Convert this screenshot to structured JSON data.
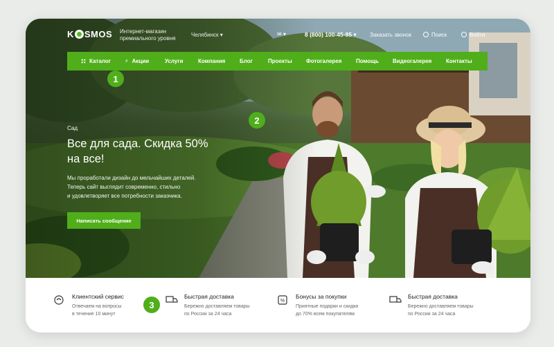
{
  "brand": {
    "logo_text_left": "K",
    "logo_text_right": "SMOS",
    "tagline_line1": "Интернет-магазин",
    "tagline_line2": "премиального уровня"
  },
  "header": {
    "city": "Челябинск",
    "phone": "8 (800) 100-45-85",
    "callback": "Заказать звонок",
    "search": "Поиск",
    "login": "Войти"
  },
  "nav": {
    "items": [
      {
        "label": "Каталог",
        "icon": "grid-icon"
      },
      {
        "label": "Акции",
        "icon": "bolt-icon"
      },
      {
        "label": "Услуги"
      },
      {
        "label": "Компания"
      },
      {
        "label": "Блог"
      },
      {
        "label": "Проекты"
      },
      {
        "label": "Фотогалерея"
      },
      {
        "label": "Помощь"
      },
      {
        "label": "Видеогалерея"
      },
      {
        "label": "Контакты"
      }
    ]
  },
  "hero": {
    "eyebrow": "Сад",
    "title_line1": "Все для сада. Скидка 50%",
    "title_line2": "на все!",
    "desc_line1": "Мы проработали дизайн до мельчайших деталей.",
    "desc_line2": "Теперь сайт выглядит современно, стильно",
    "desc_line3": "и удовлетворяет все потребности заказчика.",
    "cta": "Написать сообщение"
  },
  "badges": [
    "1",
    "2",
    "3"
  ],
  "features": [
    {
      "icon": "support-icon",
      "title": "Клиентский сервис",
      "sub1": "Отвечаем на вопросы",
      "sub2": "в течение  10 минут"
    },
    {
      "icon": "delivery-icon",
      "title": "Быстрая доставка",
      "sub1": "Бережно доставляем товары",
      "sub2": "по России за 24 часа"
    },
    {
      "icon": "discount-icon",
      "title": "Бонусы за покупки",
      "sub1": "Приятные подарки и скидки",
      "sub2": "до 70% всем покупателям"
    },
    {
      "icon": "delivery-icon",
      "title": "Быстрая доставка",
      "sub1": "Бережно доставляем товары",
      "sub2": "по России за 24 часа"
    }
  ],
  "colors": {
    "accent": "#4fae1a",
    "background": "#e9ece9"
  }
}
